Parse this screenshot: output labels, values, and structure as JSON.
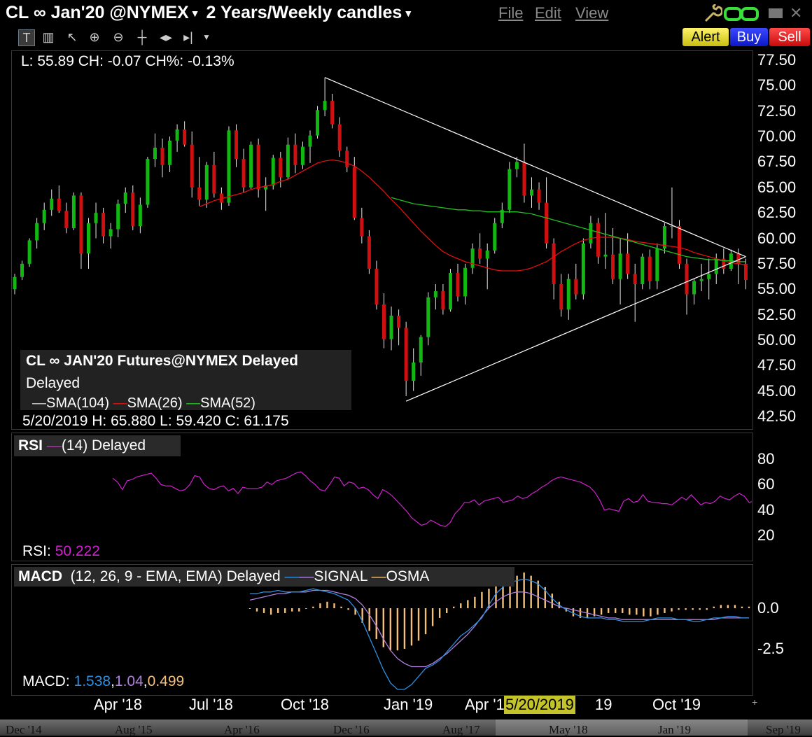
{
  "title": {
    "symbol": "CL ∞ Jan'20 @NYMEX",
    "period": "2 Years/Weekly candles"
  },
  "menu": [
    "File",
    "Edit",
    "View"
  ],
  "order_buttons": {
    "alert": "Alert",
    "buy": "Buy",
    "sell": "Sell"
  },
  "colors": {
    "up": "#11b811",
    "down": "#d01010",
    "sma104": "#ffffff",
    "sma26": "#e01010",
    "sma52": "#20c020",
    "rsi": "#d020d0",
    "macd": "#2f8fe0",
    "signal": "#b080e0",
    "osma": "#f5c07a",
    "alert": "#e8dc2a",
    "buy": "#1c29e6",
    "sell": "#e02020"
  },
  "price_panel": {
    "readout": "L: 55.89 CH: -0.07 CH%: -0.13%",
    "legend_title": "CL ∞ JAN'20 Futures@NYMEX Delayed",
    "legend_sub": "Delayed",
    "legend_sma": [
      "SMA(104)",
      "SMA(26)",
      "SMA(52)"
    ],
    "cursor_readout": "5/20/2019    H: 65.880 L: 59.420 C: 61.175",
    "y_ticks": [
      "77.50",
      "75.00",
      "72.50",
      "70.00",
      "67.50",
      "65.00",
      "62.50",
      "60.00",
      "57.50",
      "55.00",
      "52.50",
      "50.00",
      "47.50",
      "45.00",
      "42.50"
    ]
  },
  "rsi_panel": {
    "label": "RSI",
    "params": "(14) Delayed",
    "value_label": "RSI:",
    "value": "50.222",
    "y_ticks": [
      "80",
      "60",
      "40",
      "20"
    ]
  },
  "macd_panel": {
    "label": "MACD",
    "params": "(12, 26, 9 - EMA, EMA) Delayed",
    "signal_label": "SIGNAL",
    "osma_label": "OSMA",
    "value_label": "MACD:",
    "macd_value": "1.538",
    "signal_value": "1.04",
    "osma_value": "0.499",
    "y_ticks": [
      "0.0",
      "-2.5"
    ]
  },
  "time_axis": {
    "labels": [
      "Apr '18",
      "Jul '18",
      "Oct '18",
      "Jan '19",
      "Apr '19",
      "Oct '19"
    ],
    "highlight": "5/20/2019",
    "after_highlight": "19"
  },
  "scroller": {
    "labels": [
      "Dec '14",
      "Aug '15",
      "Apr '16",
      "Dec '16",
      "Aug '17",
      "May '18",
      "Jan '19",
      "Sep '19"
    ]
  },
  "chart_data": {
    "type": "candlestick",
    "x_label": "week",
    "ylim": [
      42.5,
      77.5
    ],
    "candles_ohlc": [
      [
        55.0,
        56.5,
        54.5,
        56.2
      ],
      [
        56.2,
        57.8,
        55.9,
        57.5
      ],
      [
        57.5,
        60.0,
        57.2,
        59.8
      ],
      [
        59.8,
        62.0,
        59.0,
        61.5
      ],
      [
        61.5,
        63.5,
        60.8,
        62.8
      ],
      [
        62.8,
        64.8,
        62.2,
        63.9
      ],
      [
        63.9,
        65.2,
        62.5,
        62.7
      ],
      [
        62.7,
        63.5,
        60.5,
        61.0
      ],
      [
        61.0,
        64.5,
        60.8,
        64.2
      ],
      [
        64.2,
        64.5,
        57.0,
        58.5
      ],
      [
        58.5,
        62.0,
        57.0,
        61.5
      ],
      [
        61.5,
        63.5,
        60.0,
        62.5
      ],
      [
        62.5,
        63.0,
        59.5,
        60.2
      ],
      [
        60.2,
        61.5,
        59.0,
        60.9
      ],
      [
        60.9,
        63.8,
        60.1,
        63.4
      ],
      [
        63.4,
        65.0,
        62.5,
        64.5
      ],
      [
        64.5,
        65.2,
        60.8,
        61.2
      ],
      [
        61.2,
        64.0,
        60.5,
        63.3
      ],
      [
        63.3,
        68.0,
        63.0,
        67.8
      ],
      [
        67.8,
        70.3,
        67.0,
        68.9
      ],
      [
        68.9,
        69.8,
        66.0,
        67.2
      ],
      [
        67.2,
        70.0,
        66.5,
        69.6
      ],
      [
        69.6,
        71.2,
        68.5,
        70.7
      ],
      [
        70.7,
        71.5,
        69.0,
        69.2
      ],
      [
        69.2,
        70.5,
        64.0,
        65.0
      ],
      [
        65.0,
        68.0,
        63.2,
        63.8
      ],
      [
        63.8,
        67.5,
        63.0,
        67.2
      ],
      [
        67.2,
        68.5,
        64.0,
        64.4
      ],
      [
        64.4,
        65.0,
        62.8,
        63.5
      ],
      [
        63.5,
        71.0,
        63.2,
        70.6
      ],
      [
        70.6,
        71.2,
        67.0,
        67.8
      ],
      [
        67.8,
        68.8,
        64.5,
        65.0
      ],
      [
        65.0,
        69.5,
        64.8,
        69.2
      ],
      [
        69.2,
        69.8,
        64.0,
        64.8
      ],
      [
        64.8,
        66.0,
        62.7,
        65.2
      ],
      [
        65.2,
        68.2,
        64.8,
        67.9
      ],
      [
        67.9,
        68.5,
        65.0,
        66.0
      ],
      [
        66.0,
        69.9,
        65.8,
        69.2
      ],
      [
        69.2,
        70.3,
        66.4,
        67.2
      ],
      [
        67.2,
        69.5,
        66.8,
        69.0
      ],
      [
        69.0,
        70.6,
        67.4,
        70.1
      ],
      [
        70.1,
        73.0,
        69.8,
        72.6
      ],
      [
        72.6,
        75.8,
        72.0,
        73.5
      ],
      [
        73.5,
        74.2,
        70.8,
        71.2
      ],
      [
        71.2,
        71.9,
        68.0,
        68.6
      ],
      [
        68.6,
        69.0,
        66.5,
        67.0
      ],
      [
        67.0,
        68.0,
        61.8,
        62.0
      ],
      [
        62.0,
        63.0,
        59.5,
        60.2
      ],
      [
        60.2,
        60.8,
        56.5,
        57.0
      ],
      [
        57.0,
        57.8,
        53.0,
        53.5
      ],
      [
        53.5,
        54.6,
        49.2,
        50.1
      ],
      [
        50.1,
        53.3,
        49.0,
        52.4
      ],
      [
        52.4,
        53.0,
        49.5,
        51.2
      ],
      [
        51.2,
        51.8,
        44.5,
        46.0
      ],
      [
        46.0,
        49.2,
        45.0,
        47.8
      ],
      [
        47.8,
        50.5,
        46.5,
        50.3
      ],
      [
        50.3,
        54.7,
        49.5,
        54.2
      ],
      [
        54.2,
        55.5,
        53.0,
        54.8
      ],
      [
        54.8,
        55.5,
        52.5,
        53.0
      ],
      [
        53.0,
        57.0,
        52.8,
        56.6
      ],
      [
        56.6,
        57.5,
        53.8,
        54.3
      ],
      [
        54.3,
        57.5,
        53.5,
        57.1
      ],
      [
        57.1,
        59.5,
        56.5,
        59.0
      ],
      [
        59.0,
        60.5,
        57.5,
        58.0
      ],
      [
        58.0,
        59.5,
        55.0,
        58.8
      ],
      [
        58.8,
        62.0,
        58.5,
        61.5
      ],
      [
        61.5,
        63.5,
        61.0,
        62.8
      ],
      [
        62.8,
        67.5,
        62.5,
        66.8
      ],
      [
        66.8,
        68.0,
        66.0,
        67.5
      ],
      [
        67.5,
        69.3,
        63.5,
        64.2
      ],
      [
        64.2,
        66.0,
        63.0,
        64.8
      ],
      [
        64.8,
        65.5,
        62.8,
        63.5
      ],
      [
        63.5,
        66.0,
        59.0,
        59.5
      ],
      [
        59.5,
        60.0,
        54.0,
        55.5
      ],
      [
        55.5,
        56.5,
        52.3,
        53.0
      ],
      [
        53.0,
        56.5,
        52.0,
        56.0
      ],
      [
        56.0,
        57.5,
        54.0,
        54.5
      ],
      [
        54.5,
        60.0,
        54.0,
        59.5
      ],
      [
        59.5,
        62.2,
        59.0,
        61.5
      ],
      [
        61.5,
        62.0,
        57.5,
        58.2
      ],
      [
        58.2,
        62.5,
        57.0,
        58.4
      ],
      [
        58.4,
        61.0,
        55.5,
        56.0
      ],
      [
        56.0,
        60.0,
        53.5,
        58.5
      ],
      [
        58.5,
        60.5,
        56.0,
        56.5
      ],
      [
        56.5,
        57.5,
        51.8,
        55.5
      ],
      [
        55.5,
        58.5,
        55.0,
        58.2
      ],
      [
        58.2,
        58.9,
        55.0,
        55.8
      ],
      [
        55.8,
        59.5,
        55.0,
        59.0
      ],
      [
        59.0,
        61.5,
        58.5,
        61.2
      ],
      [
        61.2,
        65.0,
        60.0,
        61.2
      ],
      [
        61.2,
        61.8,
        57.0,
        57.5
      ],
      [
        57.5,
        58.0,
        52.5,
        54.5
      ],
      [
        54.5,
        56.0,
        53.5,
        55.8
      ],
      [
        55.8,
        57.5,
        54.8,
        56.0
      ],
      [
        56.0,
        58.0,
        54.0,
        56.5
      ],
      [
        56.5,
        58.5,
        55.5,
        58.0
      ],
      [
        58.0,
        59.0,
        56.5,
        57.0
      ],
      [
        57.0,
        58.9,
        56.8,
        58.5
      ],
      [
        58.5,
        59.0,
        55.5,
        57.5
      ],
      [
        57.5,
        58.0,
        55.0,
        55.9
      ]
    ],
    "sma26": [
      null,
      null,
      null,
      null,
      null,
      null,
      null,
      null,
      null,
      null,
      null,
      null,
      null,
      null,
      null,
      null,
      null,
      null,
      null,
      null,
      null,
      null,
      null,
      null,
      null,
      63.1,
      63.4,
      63.7,
      63.9,
      64.1,
      64.3,
      64.5,
      64.8,
      65.0,
      65.1,
      65.3,
      65.6,
      65.8,
      66.2,
      66.6,
      67.0,
      67.4,
      67.6,
      67.7,
      67.6,
      67.4,
      67.1,
      66.6,
      66.0,
      65.3,
      64.6,
      63.8,
      63.1,
      62.3,
      61.5,
      60.7,
      60.0,
      59.3,
      58.7,
      58.3,
      58.0,
      57.7,
      57.5,
      57.3,
      57.1,
      56.9,
      56.8,
      56.8,
      56.8,
      56.9,
      57.1,
      57.4,
      57.7,
      58.2,
      58.7,
      59.1,
      59.5,
      59.8,
      60.0,
      60.1,
      60.1,
      60.1,
      60.0,
      59.9,
      59.7,
      59.6,
      59.5,
      59.4,
      59.3,
      59.2,
      59.1,
      58.9,
      58.6,
      58.4,
      58.2,
      58.0,
      57.8,
      57.6,
      57.5,
      57.4
    ],
    "sma52": [
      null,
      null,
      null,
      null,
      null,
      null,
      null,
      null,
      null,
      null,
      null,
      null,
      null,
      null,
      null,
      null,
      null,
      null,
      null,
      null,
      null,
      null,
      null,
      null,
      null,
      null,
      null,
      null,
      null,
      null,
      null,
      null,
      null,
      null,
      null,
      null,
      null,
      null,
      null,
      null,
      null,
      null,
      null,
      null,
      null,
      null,
      null,
      null,
      null,
      null,
      null,
      64.0,
      63.8,
      63.6,
      63.4,
      63.3,
      63.2,
      63.1,
      63.0,
      62.9,
      62.8,
      62.8,
      62.7,
      62.7,
      62.6,
      62.6,
      62.6,
      62.6,
      62.6,
      62.5,
      62.4,
      62.2,
      62.0,
      61.8,
      61.6,
      61.4,
      61.2,
      61.0,
      60.8,
      60.6,
      60.4,
      60.2,
      60.0,
      59.8,
      59.6,
      59.4,
      59.2,
      59.0,
      58.8,
      58.6,
      58.4,
      58.2,
      58.1,
      58.0,
      57.9,
      57.9,
      57.8,
      57.8,
      57.7,
      57.7
    ],
    "trendlines": [
      {
        "from": [
          42,
          75.8
        ],
        "to": [
          99,
          58.2
        ]
      },
      {
        "from": [
          53,
          44.0
        ],
        "to": [
          99,
          58.2
        ]
      }
    ],
    "rsi": [
      null,
      null,
      null,
      null,
      null,
      null,
      null,
      null,
      null,
      null,
      null,
      null,
      null,
      null,
      null,
      null,
      null,
      null,
      null,
      null,
      null,
      null,
      null,
      null,
      null,
      null,
      null,
      null,
      65,
      62,
      56,
      63,
      64,
      66,
      67,
      68,
      69,
      65,
      60,
      59,
      59,
      57,
      55,
      56,
      60,
      67,
      66,
      60,
      57,
      56,
      58,
      59,
      55,
      57,
      53,
      58,
      57,
      57,
      57,
      58,
      62,
      60,
      63,
      64,
      65,
      67,
      69,
      70,
      67,
      63,
      60,
      56,
      55,
      60,
      66,
      65,
      59,
      62,
      61,
      57,
      58,
      56,
      52,
      49,
      56,
      54,
      51,
      47,
      43,
      39,
      34,
      31,
      28,
      29,
      32,
      30,
      28,
      27,
      30,
      37,
      41,
      46,
      46,
      48,
      44,
      47,
      48,
      49,
      50,
      46,
      47,
      48,
      51,
      49,
      50,
      53,
      55,
      58,
      60,
      63,
      65,
      66,
      65,
      64,
      63,
      62,
      60,
      58,
      54,
      48,
      40,
      41,
      40,
      39,
      47,
      49,
      46,
      47,
      52,
      47,
      46,
      46,
      45,
      45,
      44,
      47,
      50,
      48,
      52,
      48,
      44,
      46,
      45,
      47,
      51,
      49,
      48,
      51,
      53,
      51,
      46,
      47
    ],
    "macd": [
      0.9,
      0.9,
      1.0,
      1.0,
      1.1,
      1.0,
      1.0,
      1.0,
      1.1,
      1.2,
      1.1,
      1.0,
      0.9,
      0.7,
      0.5,
      0.0,
      -0.8,
      -1.8,
      -2.8,
      -3.8,
      -4.6,
      -5.0,
      -5.0,
      -4.7,
      -4.2,
      -3.7,
      -3.5,
      -3.2,
      -2.7,
      -2.2,
      -1.7,
      -1.4,
      -1.0,
      -0.6,
      0.2,
      0.9,
      1.3,
      1.6,
      1.7,
      1.8,
      1.7,
      1.5,
      1.1,
      0.6,
      0.2,
      -0.1,
      -0.3,
      -0.5,
      -0.6,
      -0.6,
      -0.6,
      -0.7,
      -0.7,
      -0.8,
      -0.8,
      -0.8,
      -0.8,
      -0.7,
      -0.6,
      -0.6,
      -0.6,
      -0.7,
      -0.7,
      -0.8,
      -0.8,
      -0.7,
      -0.6,
      -0.6,
      -0.5,
      -0.5,
      -0.6,
      -0.6
    ],
    "signal": [
      0.5,
      0.6,
      0.7,
      0.8,
      0.9,
      0.9,
      1.0,
      1.0,
      1.0,
      1.1,
      1.1,
      1.1,
      1.0,
      0.9,
      0.8,
      0.6,
      0.2,
      -0.4,
      -1.1,
      -1.9,
      -2.6,
      -3.1,
      -3.4,
      -3.6,
      -3.6,
      -3.6,
      -3.4,
      -3.1,
      -2.8,
      -2.4,
      -2.0,
      -1.6,
      -1.1,
      -0.5,
      0.0,
      0.4,
      0.7,
      0.9,
      1.0,
      1.0,
      0.9,
      0.7,
      0.5,
      0.3,
      0.1,
      0.0,
      -0.1,
      -0.2,
      -0.3,
      -0.4,
      -0.5,
      -0.6,
      -0.6,
      -0.7,
      -0.7,
      -0.7,
      -0.7,
      -0.7,
      -0.7,
      -0.7,
      -0.7,
      -0.7,
      -0.7,
      -0.7,
      -0.7,
      -0.7,
      -0.7,
      -0.6,
      -0.6,
      -0.6,
      -0.6,
      -0.6
    ],
    "osma": [
      0.0,
      -0.2,
      -0.3,
      -0.4,
      -0.3,
      -0.3,
      -0.2,
      -0.2,
      0.0,
      0.1,
      0.3,
      0.4,
      0.3,
      0.1,
      -0.1,
      -0.4,
      -0.9,
      -1.4,
      -1.9,
      -2.4,
      -2.6,
      -2.6,
      -2.5,
      -2.3,
      -2.0,
      -1.6,
      -1.1,
      -0.6,
      -0.3,
      0.1,
      0.3,
      0.5,
      0.7,
      1.0,
      1.2,
      1.4,
      1.6,
      1.8,
      2.0,
      2.2,
      2.0,
      1.7,
      1.3,
      0.9,
      0.4,
      -0.2,
      -0.5,
      -0.6,
      -0.6,
      -0.5,
      -0.4,
      -0.3,
      -0.3,
      -0.3,
      -0.4,
      -0.4,
      -0.5,
      -0.5,
      -0.4,
      -0.3,
      -0.2,
      -0.1,
      -0.1,
      -0.1,
      -0.1,
      -0.1,
      0.1,
      0.2,
      0.2,
      0.2,
      0.1,
      0.1
    ]
  }
}
